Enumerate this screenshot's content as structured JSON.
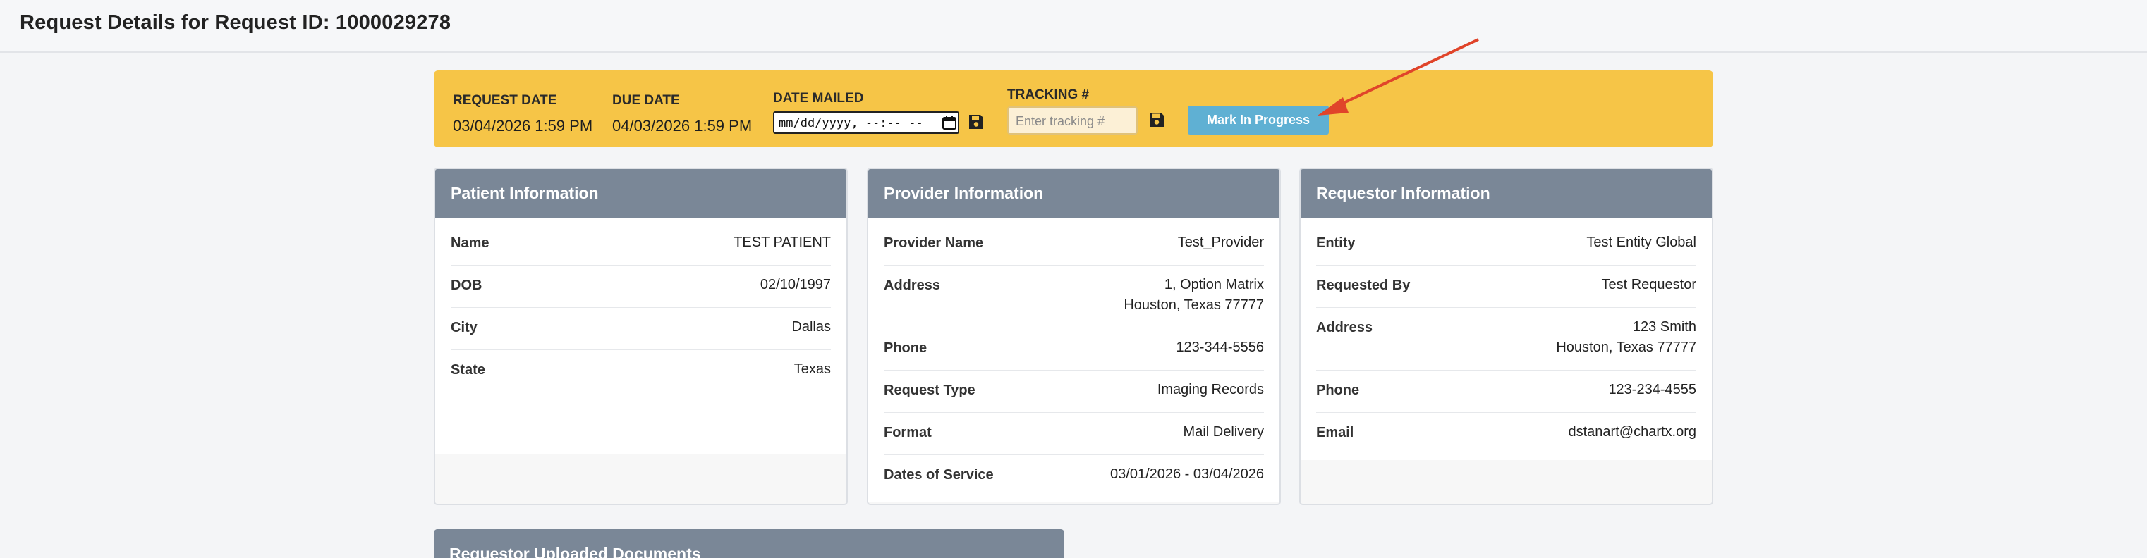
{
  "page": {
    "title": "Request Details for Request ID: 1000029278"
  },
  "status_bar": {
    "request_date": {
      "label": "REQUEST DATE",
      "value": "03/04/2026 1:59 PM"
    },
    "due_date": {
      "label": "DUE DATE",
      "value": "04/03/2026 1:59 PM"
    },
    "date_mailed": {
      "label": "DATE MAILED",
      "value": "mm/dd/yyyy, --:-- --"
    },
    "tracking": {
      "label": "TRACKING #",
      "placeholder": "Enter tracking #"
    },
    "mark_in_progress_label": "Mark In Progress"
  },
  "patient": {
    "title": "Patient Information",
    "rows": [
      {
        "label": "Name",
        "value": "TEST PATIENT"
      },
      {
        "label": "DOB",
        "value": "02/10/1997"
      },
      {
        "label": "City",
        "value": "Dallas"
      },
      {
        "label": "State",
        "value": "Texas"
      }
    ]
  },
  "provider": {
    "title": "Provider Information",
    "rows": [
      {
        "label": "Provider Name",
        "value": "Test_Provider"
      },
      {
        "label": "Address",
        "value_line1": "1, Option Matrix",
        "value_line2": "Houston, Texas 77777"
      },
      {
        "label": "Phone",
        "value": "123-344-5556"
      },
      {
        "label": "Request Type",
        "value": "Imaging Records"
      },
      {
        "label": "Format",
        "value": "Mail Delivery"
      },
      {
        "label": "Dates of Service",
        "value": "03/01/2026 - 03/04/2026"
      }
    ]
  },
  "requestor": {
    "title": "Requestor Information",
    "rows": [
      {
        "label": "Entity",
        "value": "Test Entity Global"
      },
      {
        "label": "Requested By",
        "value": "Test Requestor"
      },
      {
        "label": "Address",
        "value_line1": "123 Smith",
        "value_line2": "Houston, Texas 77777"
      },
      {
        "label": "Phone",
        "value": "123-234-4555"
      },
      {
        "label": "Email",
        "value": "dstanart@chartx.org"
      }
    ]
  },
  "documents": {
    "title": "Requestor Uploaded Documents"
  },
  "icons": {
    "save": "floppy-disk-icon",
    "calendar": "calendar-icon",
    "annotation": "red-arrow-annotation"
  },
  "colors": {
    "status_bar": "#f6c547",
    "card_header": "#7a8797",
    "mark_in_progress_button": "#5fb0d3",
    "annotation_arrow": "#e0442a"
  }
}
